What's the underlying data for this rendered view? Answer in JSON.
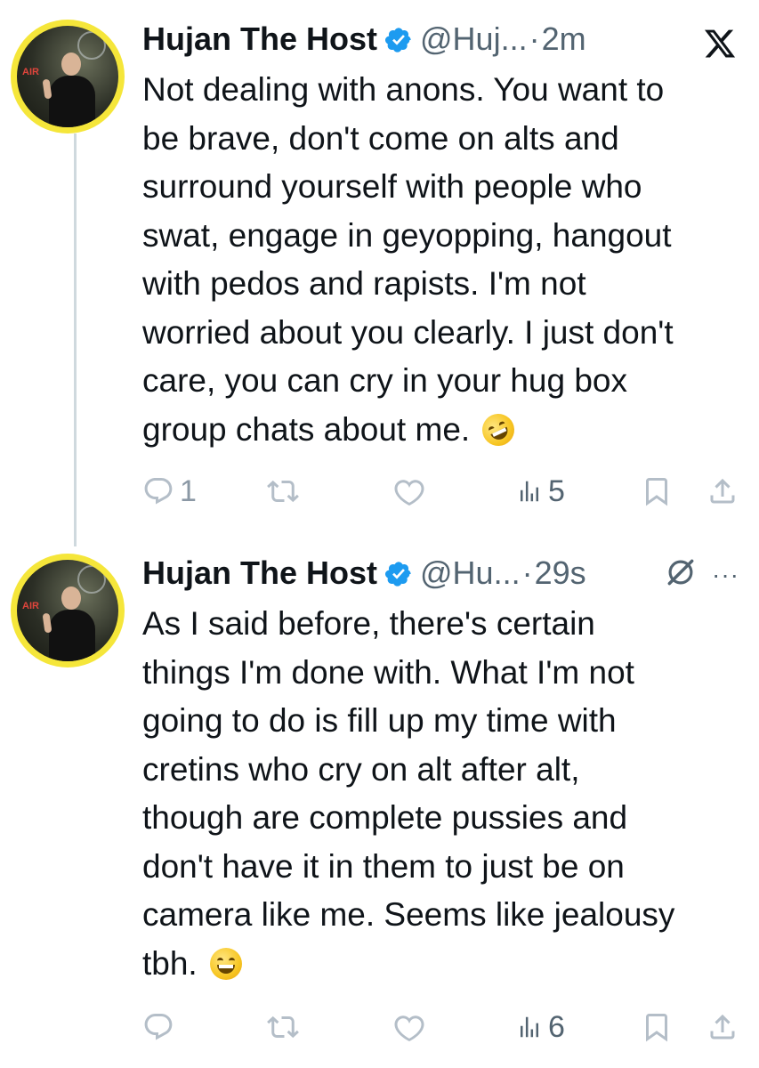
{
  "colors": {
    "text": "#0f1419",
    "secondary": "#536471",
    "action": "#8b98a5",
    "verified": "#1d9bf0",
    "avatar_ring": "#f5e63a",
    "thread_line": "#cfd9de"
  },
  "tweets": [
    {
      "name": "Hujan The Host",
      "handle": "@Huj...",
      "time": "2m",
      "text": "Not dealing with anons. You want to\nbe brave, don't come on alts and\nsurround yourself with people who\nswat, engage in geyopping, hangout\nwith pedos and rapists. I'm not\nworried about you clearly. I just don't\ncare, you can cry in your hug box\ngroup chats about me.",
      "emoji": "rolling-on-floor-laughing",
      "replies": "1",
      "views": "5",
      "corner_icon": "x-logo-icon"
    },
    {
      "name": "Hujan The Host",
      "handle": "@Hu...",
      "time": "29s",
      "text": "As I said before, there's certain\nthings I'm done with. What I'm not\ngoing to do is fill up my time with\ncretins who cry on alt after alt,\nthough are complete pussies and\ndon't have it in them to just be on\ncamera like me. Seems like jealousy\ntbh.",
      "emoji": "grinning-face-with-smiling-eyes",
      "replies": "",
      "views": "6",
      "corner_icon": "more-icon",
      "more": "···"
    }
  ],
  "separator": "·",
  "avatar_sign": "AIR"
}
